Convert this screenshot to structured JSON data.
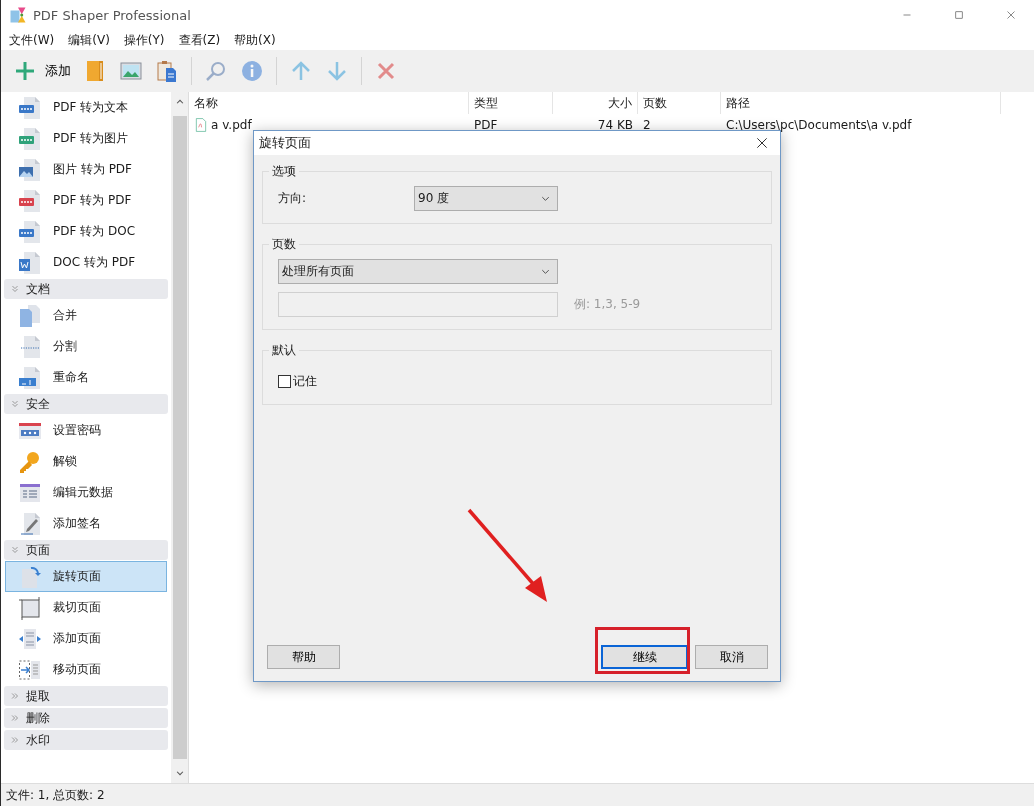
{
  "window": {
    "title": "PDF Shaper Professional"
  },
  "menu": [
    "文件(W)",
    "编辑(V)",
    "操作(Y)",
    "查看(Z)",
    "帮助(X)"
  ],
  "toolbar": [
    {
      "kind": "add",
      "label": "添加",
      "disabled": false
    },
    {
      "kind": "folder",
      "disabled": false
    },
    {
      "kind": "image",
      "disabled": false
    },
    {
      "kind": "clipboard",
      "disabled": false
    },
    {
      "kind": "separator"
    },
    {
      "kind": "search",
      "disabled": true
    },
    {
      "kind": "info",
      "disabled": true
    },
    {
      "kind": "separator"
    },
    {
      "kind": "up",
      "disabled": true
    },
    {
      "kind": "down",
      "disabled": true
    },
    {
      "kind": "separator"
    },
    {
      "kind": "delete",
      "disabled": true
    }
  ],
  "sidebar": {
    "groups": [
      {
        "items": [
          {
            "label": "PDF 转为文本",
            "kind": "txt",
            "selected": false
          },
          {
            "label": "PDF 转为图片",
            "kind": "jpg",
            "selected": false
          },
          {
            "label": "图片 转为 PDF",
            "kind": "image",
            "selected": false
          },
          {
            "label": "PDF 转为 PDF",
            "kind": "pdf",
            "selected": false
          },
          {
            "label": "PDF 转为 DOC",
            "kind": "doc",
            "selected": false
          },
          {
            "label": "DOC 转为 PDF",
            "kind": "word",
            "selected": false
          }
        ]
      },
      {
        "title": "文档",
        "expanded": true,
        "items": [
          {
            "label": "合并",
            "kind": "merge",
            "selected": false
          },
          {
            "label": "分割",
            "kind": "split",
            "selected": false
          },
          {
            "label": "重命名",
            "kind": "rename",
            "selected": false
          }
        ]
      },
      {
        "title": "安全",
        "expanded": true,
        "items": [
          {
            "label": "设置密码",
            "kind": "password",
            "selected": false
          },
          {
            "label": "解锁",
            "kind": "key",
            "selected": false
          },
          {
            "label": "编辑元数据",
            "kind": "metadata",
            "selected": false
          },
          {
            "label": "添加签名",
            "kind": "signature",
            "selected": false
          }
        ]
      },
      {
        "title": "页面",
        "expanded": true,
        "items": [
          {
            "label": "旋转页面",
            "kind": "rotate",
            "selected": true
          },
          {
            "label": "裁切页面",
            "kind": "crop",
            "selected": false
          },
          {
            "label": "添加页面",
            "kind": "add_page",
            "selected": false
          },
          {
            "label": "移动页面",
            "kind": "move_page",
            "selected": false
          }
        ]
      },
      {
        "title": "提取",
        "expanded": false
      },
      {
        "title": "删除",
        "expanded": false
      },
      {
        "title": "水印",
        "expanded": false
      }
    ]
  },
  "table": {
    "columns": [
      "名称",
      "类型",
      "大小",
      "页数",
      "路径"
    ],
    "rows": [
      [
        "a v.pdf",
        "PDF",
        "74 KB",
        "2",
        "C:\\Users\\pc\\Documents\\a v.pdf"
      ]
    ]
  },
  "dialog": {
    "title": "旋转页面",
    "options": {
      "legend": "选项",
      "direction_label": "方向:",
      "direction_value": "90 度"
    },
    "pages": {
      "legend": "页数",
      "scope_value": "处理所有页面",
      "hint": "例: 1,3, 5-9"
    },
    "defaults": {
      "legend": "默认",
      "remember": {
        "label": "记住",
        "checked": false
      }
    },
    "buttons": [
      {
        "label": "帮助",
        "default": false
      },
      {
        "label": "继续",
        "default": true
      },
      {
        "label": "取消",
        "default": false
      }
    ]
  },
  "annotations": {
    "arrow": {
      "color": "#e02020"
    },
    "highlight_box": {
      "color": "#d6202a"
    }
  },
  "status_bar": "文件: 1, 总页数: 2"
}
